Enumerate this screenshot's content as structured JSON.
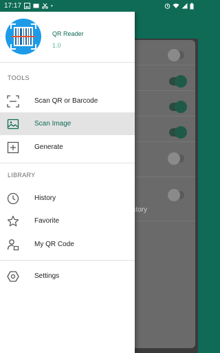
{
  "status_bar": {
    "time": "17:17"
  },
  "app": {
    "name": "QR Reader",
    "version": "1.0"
  },
  "sections": {
    "tools": "TOOLS",
    "library": "LIBRARY"
  },
  "menu": {
    "scan_code": "Scan QR or Barcode",
    "scan_image": "Scan Image",
    "generate": "Generate",
    "history": "History",
    "favorite": "Favorite",
    "my_qr_code": "My QR Code",
    "settings": "Settings"
  },
  "background": {
    "partial_text": "in history"
  },
  "colors": {
    "primary": "#0f6b55",
    "accent": "#1e9be8",
    "active_row": "#e3e3e3"
  },
  "icons": [
    "scan-frame-icon",
    "image-icon",
    "add-box-icon",
    "clock-icon",
    "star-icon",
    "person-card-icon",
    "gear-icon"
  ]
}
